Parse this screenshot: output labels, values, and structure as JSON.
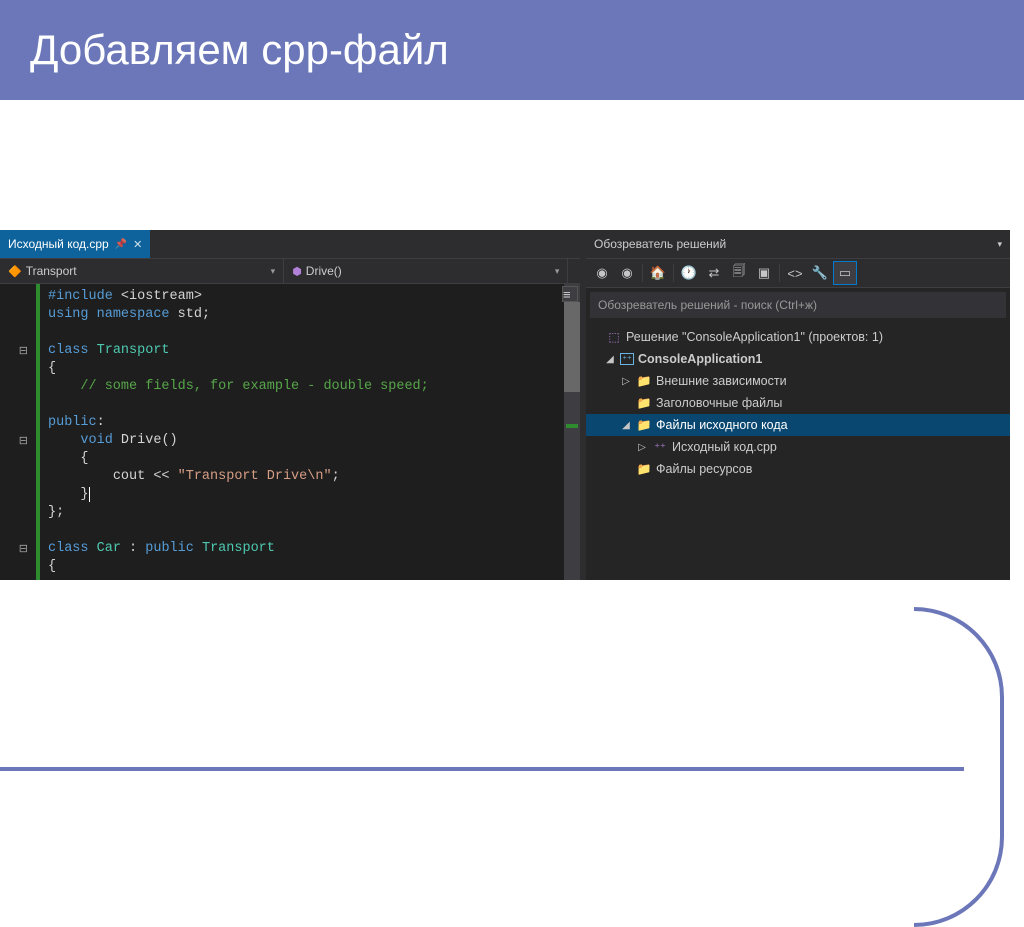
{
  "slide": {
    "title": "Добавляем cpp-файл"
  },
  "tab": {
    "name": "Исходный код.cpp"
  },
  "nav": {
    "scope": "Transport",
    "member": "Drive()"
  },
  "code": {
    "l1_include": "#include",
    "l1_lib": "<iostream>",
    "l2_using": "using",
    "l2_ns": "namespace",
    "l2_std": "std",
    "l4_class": "class",
    "l4_name": "Transport",
    "l6_comment": "// some fields, for example - double speed;",
    "l8_public": "public",
    "l9_void": "void",
    "l9_fn": "Drive",
    "l11_cout": "cout",
    "l11_op": " << ",
    "l11_str": "\"Transport Drive\\n\"",
    "l15_class": "class",
    "l15_name": "Car",
    "l15_colon": " : ",
    "l15_pub": "public",
    "l15_base": "Transport"
  },
  "explorer": {
    "title": "Обозреватель решений",
    "search_placeholder": "Обозреватель решений - поиск (Ctrl+ж)",
    "solution_prefix": "Решение \"",
    "solution_name": "ConsoleApplication1",
    "solution_suffix": "\" (проектов: 1)",
    "project": "ConsoleApplication1",
    "nodes": {
      "ext_deps": "Внешние зависимости",
      "headers": "Заголовочные файлы",
      "src_files": "Файлы исходного кода",
      "src_cpp": "Исходный код.cpp",
      "resources": "Файлы ресурсов"
    }
  }
}
